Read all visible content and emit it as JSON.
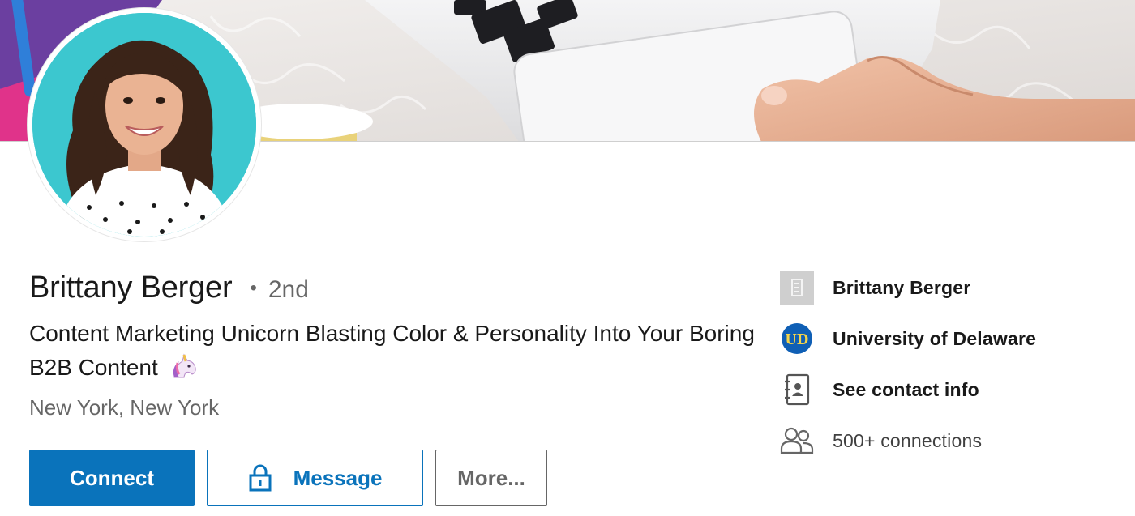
{
  "profile": {
    "name": "Brittany Berger",
    "separator": "•",
    "degree": "2nd",
    "headline": "Content Marketing Unicorn Blasting Color & Personality Into Your Boring B2B Content",
    "headline_emoji": "unicorn-icon",
    "location": "New York, New York"
  },
  "actions": {
    "connect_label": "Connect",
    "message_label": "Message",
    "more_label": "More..."
  },
  "sidebar": {
    "items": [
      {
        "icon": "company-building-icon",
        "label": "Brittany Berger"
      },
      {
        "icon": "university-logo-icon",
        "label": "University of Delaware"
      },
      {
        "icon": "contact-book-icon",
        "label": "See contact info"
      },
      {
        "icon": "people-icon",
        "label": "500+ connections"
      }
    ]
  },
  "colors": {
    "primary": "#0a73bb",
    "avatar_background": "#3cc7cf",
    "university_blue": "#0f5fb5"
  }
}
